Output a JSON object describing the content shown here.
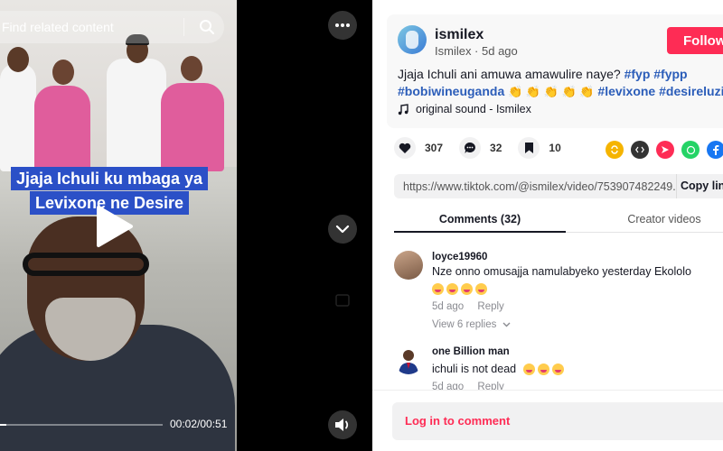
{
  "video": {
    "search_placeholder": "Find related content",
    "caption_lines": [
      "Jjaja Ichuli ku mbaga ya",
      "Levixone ne Desire"
    ],
    "time": "00:02/00:51",
    "progress": 0.04
  },
  "post": {
    "username": "ismilex",
    "meta": "Ismilex · 5d ago",
    "follow_label": "Follow",
    "desc_text": "Jjaja Ichuli ani amuwa amawulire naye? ",
    "tags_line1": [
      "#fyp",
      "#fypp"
    ],
    "tags_line2a": "#bobiwineuganda",
    "tags_line2b": [
      "#levixone",
      "#desireluzinda"
    ],
    "sound": "original sound - Ismilex"
  },
  "actions": {
    "likes": "307",
    "comments": "32",
    "saves": "10"
  },
  "link": {
    "url": "https://www.tiktok.com/@ismilex/video/753907482249...",
    "copy_label": "Copy link"
  },
  "tabs": {
    "comments": "Comments (32)",
    "creator": "Creator videos"
  },
  "comments": [
    {
      "user": "loyce19960",
      "text": "Nze onno omusajja namulabyeko yesterday Ekololo",
      "date": "5d ago",
      "reply": "Reply",
      "view_replies": "View 6 replies"
    },
    {
      "user": "one Billion man",
      "text": "ichuli is not dead",
      "date": "5d ago",
      "reply": "Reply"
    }
  ],
  "footer": {
    "login_label": "Log in to comment"
  },
  "colors": {
    "accent": "#fe2c55",
    "hashtag": "#2b5db9",
    "caption_bg": "#2b50c7"
  }
}
